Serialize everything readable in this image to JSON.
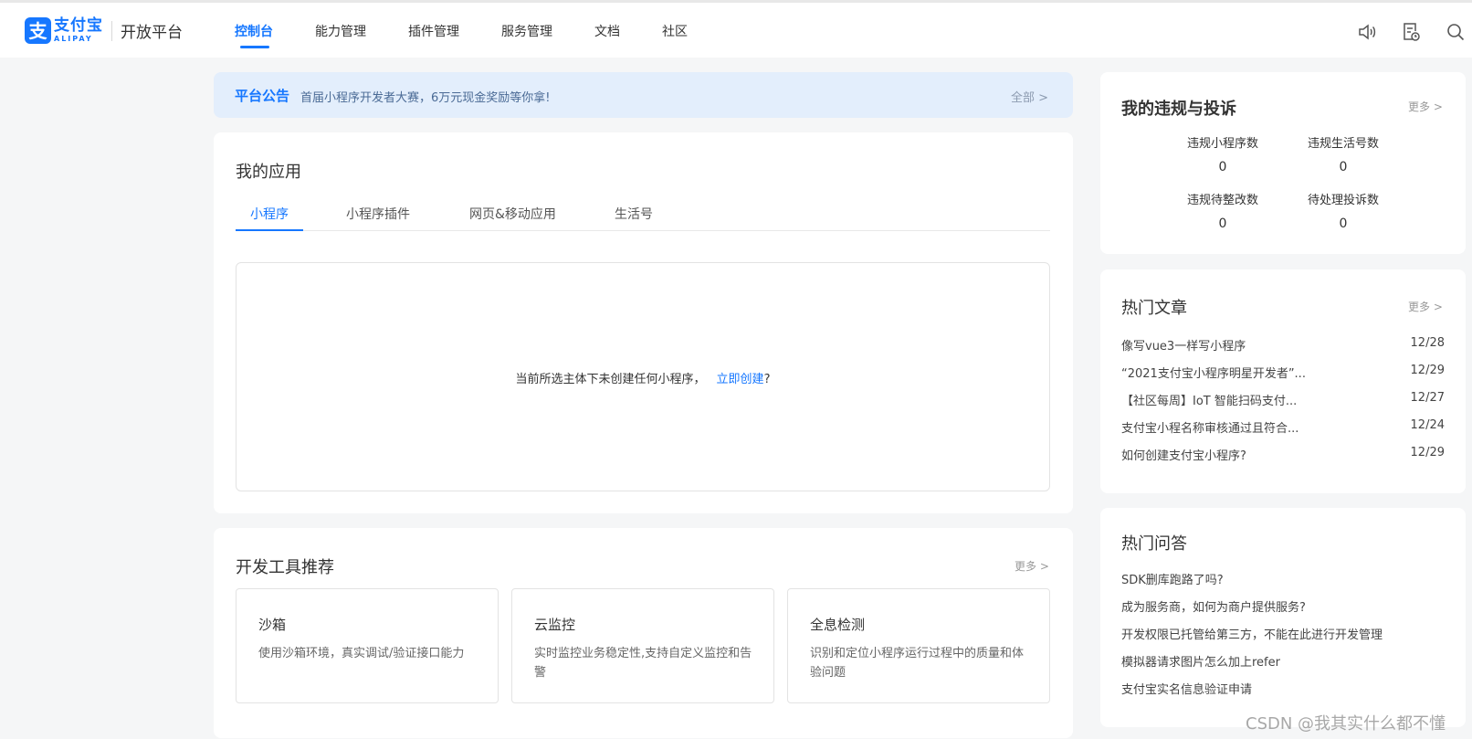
{
  "brand": {
    "mark": "支",
    "name_cn": "支付宝",
    "name_en": "ALIPAY",
    "platform": "开放平台",
    "accent": "#1677ff"
  },
  "nav": {
    "items": [
      {
        "label": "控制台",
        "active": true
      },
      {
        "label": "能力管理"
      },
      {
        "label": "插件管理"
      },
      {
        "label": "服务管理"
      },
      {
        "label": "文档"
      },
      {
        "label": "社区"
      }
    ],
    "icons": [
      "speaker-icon",
      "document-clock-icon",
      "search-icon"
    ]
  },
  "notice": {
    "title": "平台公告",
    "text": "首届小程序开发者大赛，6万元现金奖励等你拿!",
    "all_label": "全部 >"
  },
  "my_apps": {
    "title": "我的应用",
    "tabs": [
      {
        "label": "小程序",
        "active": true
      },
      {
        "label": "小程序插件"
      },
      {
        "label": "网页&移动应用"
      },
      {
        "label": "生活号"
      }
    ],
    "empty_text": "当前所选主体下未创建任何小程序，",
    "create_link": "立即创建",
    "create_suffix": "?"
  },
  "dev_tools": {
    "title": "开发工具推荐",
    "more": "更多 >",
    "items": [
      {
        "name": "沙箱",
        "desc": "使用沙箱环境，真实调试/验证接口能力"
      },
      {
        "name": "云监控",
        "desc": "实时监控业务稳定性,支持自定义监控和告警"
      },
      {
        "name": "全息检测",
        "desc": "识别和定位小程序运行过程中的质量和体验问题"
      }
    ]
  },
  "violations": {
    "title": "我的违规与投诉",
    "more": "更多 >",
    "stats": [
      {
        "label": "违规小程序数",
        "value": "0"
      },
      {
        "label": "违规生活号数",
        "value": "0"
      },
      {
        "label": "违规待整改数",
        "value": "0"
      },
      {
        "label": "待处理投诉数",
        "value": "0"
      }
    ]
  },
  "hot_articles": {
    "title": "热门文章",
    "more": "更多 >",
    "items": [
      {
        "title": "像写vue3一样写小程序",
        "date": "12/28"
      },
      {
        "title": "“2021支付宝小程序明星开发者”...",
        "date": "12/29"
      },
      {
        "title": "【社区每周】IoT 智能扫码支付...",
        "date": "12/27"
      },
      {
        "title": "支付宝小程名称审核通过且符合...",
        "date": "12/24"
      },
      {
        "title": "如何创建支付宝小程序?",
        "date": "12/29"
      }
    ]
  },
  "hot_qa": {
    "title": "热门问答",
    "items": [
      "SDK删库跑路了吗?",
      "成为服务商，如何为商户提供服务?",
      "开发权限已托管给第三方，不能在此进行开发管理",
      "模拟器请求图片怎么加上refer",
      "支付宝实名信息验证申请"
    ]
  },
  "watermark": "CSDN @我其实什么都不懂"
}
